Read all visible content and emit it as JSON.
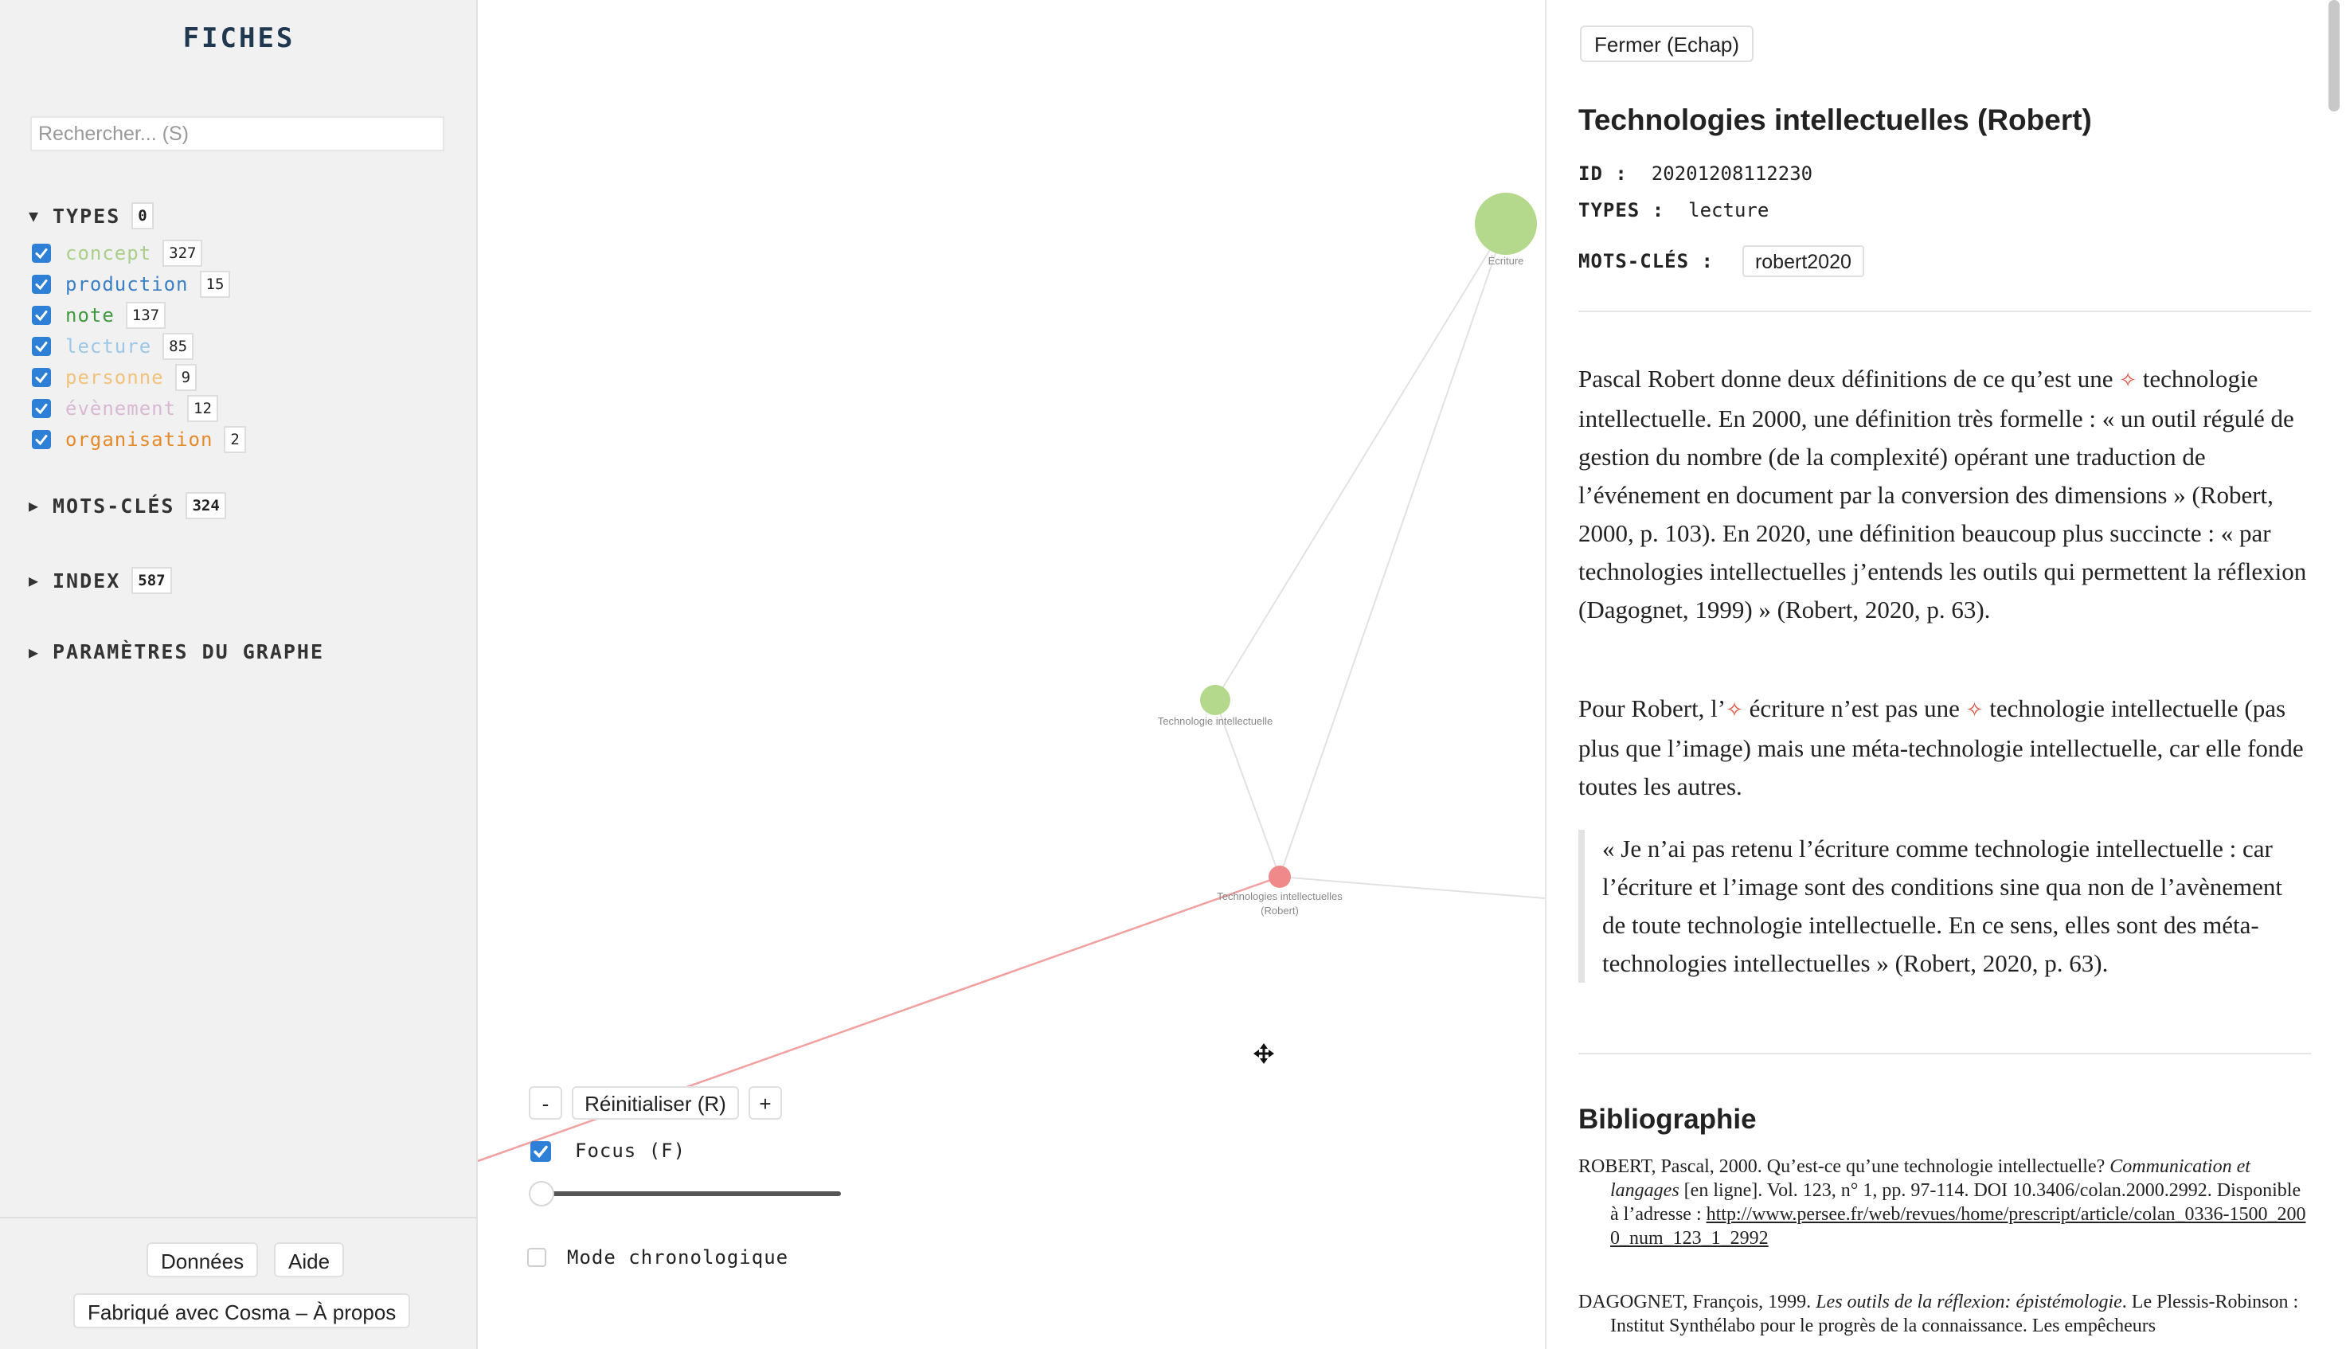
{
  "sidebar": {
    "title": "FICHES",
    "search_placeholder": "Rechercher... (S)",
    "types": {
      "label": "TYPES",
      "count": "0",
      "items": [
        {
          "label": "concept",
          "count": "327",
          "color": "#a9cf8a"
        },
        {
          "label": "production",
          "count": "15",
          "color": "#3b7fc4"
        },
        {
          "label": "note",
          "count": "137",
          "color": "#3f9a3f"
        },
        {
          "label": "lecture",
          "count": "85",
          "color": "#9cc7e8"
        },
        {
          "label": "personne",
          "count": "9",
          "color": "#f2c27a"
        },
        {
          "label": "évènement",
          "count": "12",
          "color": "#d9b8d3"
        },
        {
          "label": "organisation",
          "count": "2",
          "color": "#e48a2a"
        }
      ]
    },
    "keywords": {
      "label": "MOTS-CLÉS",
      "count": "324"
    },
    "index": {
      "label": "INDEX",
      "count": "587"
    },
    "graph_settings": {
      "label": "PARAMÈTRES DU GRAPHE"
    },
    "footer": {
      "data_button": "Données",
      "help_button": "Aide",
      "about_button": "Fabriqué avec Cosma – À propos"
    }
  },
  "graph": {
    "nodes": [
      {
        "label": "Écriture",
        "color": "#b4d88c"
      },
      {
        "label": "Technologie intellectuelle",
        "color": "#b4d88c"
      },
      {
        "label": "Technologies intellectuelles (Robert)",
        "color": "#f08a8a"
      }
    ],
    "controls": {
      "zoom_out": "-",
      "reset": "Réinitialiser (R)",
      "zoom_in": "+",
      "focus_label": "Focus (F)",
      "focus_checked": true,
      "chrono_label": "Mode chronologique",
      "chrono_checked": false,
      "focus_level": 0
    },
    "accent_color": "#2e7fd6",
    "highlight_link_color": "#f0a0a0"
  },
  "panel": {
    "close_button": "Fermer (Echap)",
    "title": "Technologies intellectuelles (Robert)",
    "id_key": "ID :",
    "id_value": "20201208112230",
    "types_key": "TYPES :",
    "types_value": "lecture",
    "keywords_key": "MOTS-CLÉS :",
    "keyword": "robert2020",
    "p1": {
      "a": "Pascal Robert donne deux définitions de ce qu’est une ",
      "b": "technologie intellectuelle. En 2000, une définition très formelle : « un outil régulé de gestion du nombre (de la complexité) opérant une traduction de l’événement en document par la conversion des dimensions » (Robert, 2000, p. 103). En 2020, une définition beaucoup plus succincte : « par technologies intellectuelles j’entends les outils qui permettent la réflexion (Dagognet, 1999) » (Robert, 2020, p. 63)."
    },
    "p2": {
      "a": "Pour Robert, l’",
      "b": "écriture n’est pas une ",
      "c": "technologie intellectuelle (pas plus que l’image) mais une méta-technologie intellectuelle, car elle fonde toutes les autres."
    },
    "link_marker": "✧",
    "quote": "« Je n’ai pas retenu l’écriture comme technologie intellectuelle : car l’écriture et l’image sont des conditions sine qua non de l’avènement de toute technologie intellectuelle. En ce sens, elles sont des méta-technologies intellectuelles » (Robert, 2020, p. 63).",
    "bibliography": {
      "heading": "Bibliographie",
      "entry1": {
        "a": "ROBERT, Pascal, 2000. Qu’est-ce qu’une technologie intellectuelle? ",
        "journal": "Communication et langages",
        "b": " [en ligne]. Vol. 123, n° 1, pp. 97-114. DOI 10.3406/colan.2000.2992. Disponible à l’adresse : ",
        "url": "http://www.persee.fr/web/revues/home/prescript/article/colan_0336-1500_2000_num_123_1_2992"
      },
      "entry2": {
        "a": "DAGOGNET, François, 1999. ",
        "title": "Les outils de la réflexion: épistémologie",
        "b": ". Le Plessis-Robinson : Institut Synthélabo pour le progrès de la connaissance. Les empêcheurs"
      }
    }
  }
}
